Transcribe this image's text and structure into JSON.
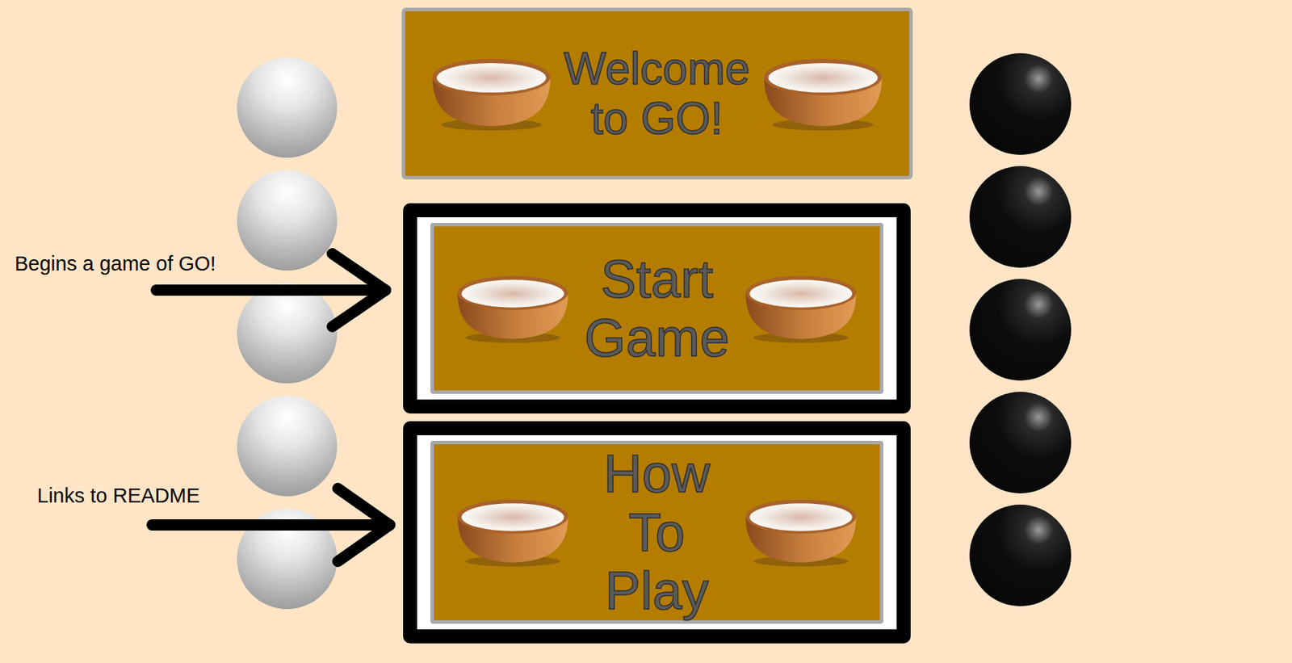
{
  "title": "Welcome to GO!",
  "buttons": [
    {
      "label": "Start Game"
    },
    {
      "label": "How To Play"
    }
  ],
  "annotations": [
    {
      "text": "Begins a game of GO!"
    },
    {
      "text": "Links to README"
    }
  ]
}
